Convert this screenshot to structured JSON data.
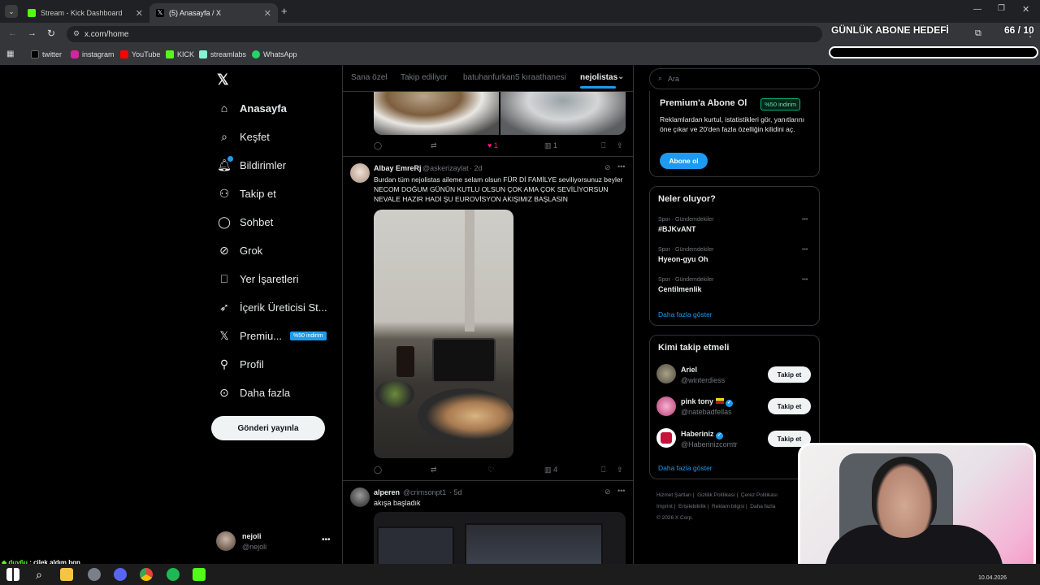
{
  "browser": {
    "tabs": [
      {
        "label": "Stream - Kick Dashboard"
      },
      {
        "label": "(5) Anasayfa / X"
      }
    ],
    "url": "x.com/home",
    "bookmarks": [
      "twitter",
      "instagram",
      "YouTube",
      "KICK",
      "streamlabs",
      "WhatsApp"
    ]
  },
  "overlay": {
    "goal_title": "GÜNLÜK ABONE HEDEFİ",
    "goal_count": "66 / 10",
    "chat_user": "duy6u",
    "chat_message": ": çilek aldım bgn"
  },
  "sidebar": {
    "items": [
      {
        "label": "Anasayfa",
        "icon": "home-icon"
      },
      {
        "label": "Keşfet",
        "icon": "search-icon"
      },
      {
        "label": "Bildirimler",
        "icon": "bell-icon"
      },
      {
        "label": "Takip et",
        "icon": "add-user-icon"
      },
      {
        "label": "Sohbet",
        "icon": "chat-icon"
      },
      {
        "label": "Grok",
        "icon": "grok-icon"
      },
      {
        "label": "Yer İşaretleri",
        "icon": "bookmark-icon"
      },
      {
        "label": "İçerik Üreticisi St...",
        "icon": "rocket-icon"
      },
      {
        "label": "Premiu...",
        "icon": "x-logo-icon",
        "badge": "%50 indirim"
      },
      {
        "label": "Profil",
        "icon": "person-icon"
      },
      {
        "label": "Daha fazla",
        "icon": "more-circle-icon"
      }
    ],
    "post_button": "Gönderi yayınla",
    "account": {
      "name": "nejoli",
      "handle": "@nejoli"
    }
  },
  "timeline": {
    "tabs": [
      "Sana özel",
      "Takip ediliyor",
      "batuhanfurkan5 kıraathanesi",
      "nejolistas"
    ],
    "prev_actions": {
      "likes": "1",
      "views": "1"
    },
    "tweets": [
      {
        "name": "Albay EmreRj",
        "handle": "@askerizaylat",
        "time": "· 2d",
        "text": "Burdan tüm nejolistas aileme selam olsun FÜR Dİ FAMİLYE seviliyorsunuz beyler NECOM DOĞUM GÜNÜN KUTLU OLSUN ÇOK AMA ÇOK SEVİLİYORSUN NEVALE HAZIR HADİ ŞU EUROVİSYON AKIŞIMIZ BAŞLASIN",
        "views": "4"
      },
      {
        "name": "alperen",
        "handle": "@crimsonpt1",
        "time": "· 5d",
        "text": "akışa başladık"
      }
    ]
  },
  "right": {
    "search_placeholder": "Ara",
    "premium": {
      "title": "Premium'a Abone Ol",
      "badge": "%50 indirim",
      "text": "Reklamlardan kurtul, istatistikleri gör, yanıtlarını öne çıkar ve 20'den fazla özelliğin kilidini aç.",
      "button": "Abone ol"
    },
    "trends": {
      "title": "Neler oluyor?",
      "items": [
        {
          "meta": "Spor · Gündemdekiler",
          "name": "#BJKvANT"
        },
        {
          "meta": "Spor · Gündemdekiler",
          "name": "Hyeon-gyu Oh"
        },
        {
          "meta": "Spor · Gündemdekiler",
          "name": "Centilmenlik"
        }
      ],
      "more": "Daha fazla göster"
    },
    "who_to_follow": {
      "title": "Kimi takip etmeli",
      "items": [
        {
          "name": "Ariel",
          "handle": "@winterdiess",
          "button": "Takip et"
        },
        {
          "name": "pink tony",
          "handle": "@natebadfellas",
          "button": "Takip et"
        },
        {
          "name": "Haberiniz",
          "handle": "@Haberinizcomtr",
          "button": "Takip et"
        }
      ],
      "more": "Daha fazla göster"
    },
    "footer": [
      "Hizmet Şartları",
      "Gizlilik Politikası",
      "Çerez Politikası",
      "Imprint",
      "Erişilebilirlik",
      "Reklam bilgisi",
      "Daha fazla",
      "© 2026 X Corp."
    ]
  },
  "taskbar": {
    "date": "10.04.2026"
  }
}
